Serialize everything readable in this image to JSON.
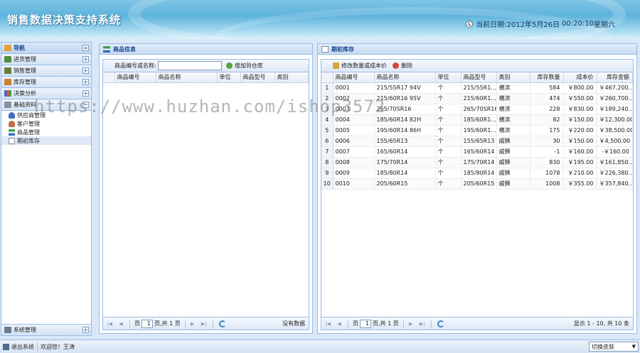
{
  "header": {
    "title": "销售数据决策支持系统",
    "date_label": "当前日期:",
    "date_value": "2012年5月26日",
    "time_value": "00:20:10",
    "weekday": "星期六"
  },
  "sidebar": {
    "nav_title": "导航",
    "collapse_symbol": "«",
    "sections": [
      {
        "label": "进货管理",
        "tool": "+"
      },
      {
        "label": "销售管理",
        "tool": "+"
      },
      {
        "label": "库存管理",
        "tool": "+"
      },
      {
        "label": "决策分析",
        "tool": "+"
      },
      {
        "label": "基础资料",
        "tool": "−"
      }
    ],
    "sub_items": [
      {
        "label": "供应商管理"
      },
      {
        "label": "客户管理"
      },
      {
        "label": "商品管理"
      },
      {
        "label": "期初库存"
      }
    ],
    "system_label": "系统管理",
    "system_tool": "+"
  },
  "left_panel": {
    "title": "商品信息",
    "search_label": "商品编号或名称:",
    "search_value": "",
    "add_button": "增加到仓库",
    "columns": [
      "商品编号",
      "商品名称",
      "单位",
      "商品型号",
      "类别"
    ],
    "pager": {
      "page_label_pre": "页",
      "page_value": "1",
      "page_label_post": "页,共 1 页",
      "info": "没有数据"
    }
  },
  "right_panel": {
    "title": "期初库存",
    "edit_button": "修改数量或成本价",
    "delete_button": "删除",
    "columns": [
      "商品编号",
      "商品名称",
      "单位",
      "商品型号",
      "类别",
      "库存数量",
      "成本价",
      "库存金额"
    ],
    "rows": [
      {
        "n": "1",
        "code": "0001",
        "name": "215/55R17 94V",
        "unit": "个",
        "model": "215/55R1...",
        "cat": "横滨",
        "qty": "584",
        "cost": "￥800.00",
        "amount": "￥467,200..."
      },
      {
        "n": "2",
        "code": "0002",
        "name": "215/60R16 95V",
        "unit": "个",
        "model": "215/60R1...",
        "cat": "横滨",
        "qty": "474",
        "cost": "￥550.00",
        "amount": "￥260,700..."
      },
      {
        "n": "3",
        "code": "0003",
        "name": "265/70SR16",
        "unit": "个",
        "model": "265/70SR16",
        "cat": "横滨",
        "qty": "228",
        "cost": "￥830.00",
        "amount": "￥189,240..."
      },
      {
        "n": "4",
        "code": "0004",
        "name": "185/60R14 82H",
        "unit": "个",
        "model": "185/60R1...",
        "cat": "横滨",
        "qty": "82",
        "cost": "￥150.00",
        "amount": "￥12,300.00"
      },
      {
        "n": "5",
        "code": "0005",
        "name": "195/60R14 86H",
        "unit": "个",
        "model": "195/60R1...",
        "cat": "横滨",
        "qty": "175",
        "cost": "￥220.00",
        "amount": "￥38,500.00"
      },
      {
        "n": "6",
        "code": "0006",
        "name": "155/65R13",
        "unit": "个",
        "model": "155/65R13",
        "cat": "威狮",
        "qty": "30",
        "cost": "￥150.00",
        "amount": "￥4,500.00"
      },
      {
        "n": "7",
        "code": "0007",
        "name": "165/60R14",
        "unit": "个",
        "model": "165/60R14",
        "cat": "威狮",
        "qty": "-1",
        "cost": "￥160.00",
        "amount": "-￥160.00"
      },
      {
        "n": "8",
        "code": "0008",
        "name": "175/70R14",
        "unit": "个",
        "model": "175/70R14",
        "cat": "威狮",
        "qty": "830",
        "cost": "￥195.00",
        "amount": "￥161,850..."
      },
      {
        "n": "9",
        "code": "0009",
        "name": "185/80R14",
        "unit": "个",
        "model": "185/80R14",
        "cat": "威狮",
        "qty": "1078",
        "cost": "￥210.00",
        "amount": "￥226,380..."
      },
      {
        "n": "10",
        "code": "0010",
        "name": "205/60R15",
        "unit": "个",
        "model": "205/60R15",
        "cat": "威狮",
        "qty": "1008",
        "cost": "￥355.00",
        "amount": "￥357,840..."
      }
    ],
    "pager": {
      "page_label_pre": "页",
      "page_value": "1",
      "page_label_post": "页,共 1 页",
      "info": "显示 1 - 10, 共 10 条"
    }
  },
  "footer": {
    "logout": "退出系统",
    "welcome": "欢迎您！王涛",
    "skin_select": "切换皮肤"
  },
  "watermark": "https://www.huzhan.com/ishop3572",
  "colors": {
    "panel_border": "#99bbe8",
    "header_text": "#15428b",
    "header_bg": "#5db3dc"
  }
}
